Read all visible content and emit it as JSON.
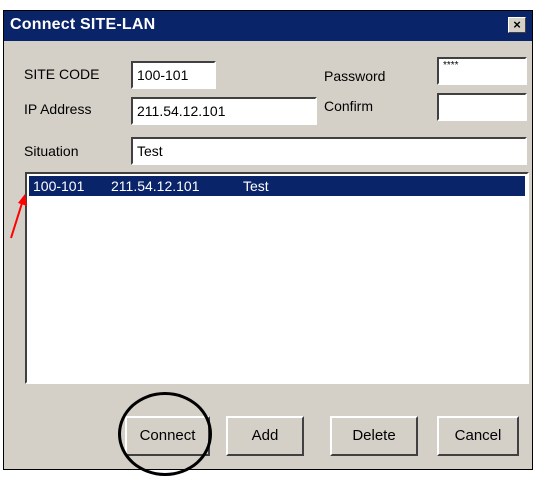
{
  "window": {
    "title": "Connect SITE-LAN",
    "close_glyph": "×"
  },
  "form": {
    "site_code_label": "SITE CODE",
    "site_code_value": "100-101",
    "password_label": "Password",
    "password_value": "****",
    "ip_label": "IP Address",
    "ip_value": "211.54.12.101",
    "confirm_label": "Confirm",
    "confirm_value": "",
    "situation_label": "Situation",
    "situation_value": "Test"
  },
  "list": {
    "items": [
      {
        "site_code": "100-101",
        "ip": "211.54.12.101",
        "situation": "Test",
        "selected": true
      }
    ]
  },
  "buttons": {
    "connect": "Connect",
    "add": "Add",
    "delete": "Delete",
    "cancel": "Cancel"
  },
  "annotations": {
    "circle_color": "#000000",
    "arrow_color": "#ff0000"
  }
}
